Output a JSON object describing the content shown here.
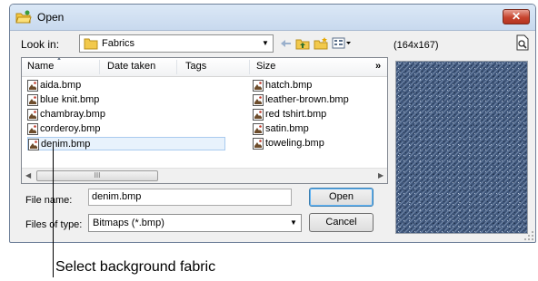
{
  "window": {
    "title": "Open",
    "close_glyph": "✕",
    "icon": "open-folder-icon"
  },
  "toolbar": {
    "look_in_label": "Look in:",
    "look_in_value": "Fabrics",
    "back_icon": "back-arrow-icon",
    "up_icon": "up-folder-icon",
    "new_folder_icon": "new-folder-icon",
    "views_icon": "views-menu-icon"
  },
  "preview_info": {
    "dimensions": "(164x167)"
  },
  "list": {
    "columns": [
      "Name",
      "Date taken",
      "Tags",
      "Size"
    ],
    "more_columns": "»",
    "files": [
      "aida.bmp",
      "blue knit.bmp",
      "chambray.bmp",
      "corderoy.bmp",
      "denim.bmp",
      "hatch.bmp",
      "leather-brown.bmp",
      "red tshirt.bmp",
      "satin.bmp",
      "toweling.bmp"
    ],
    "selected_index": 4,
    "scroll_thumb": "III"
  },
  "form": {
    "file_name_label": "File name:",
    "file_name_value": "denim.bmp",
    "files_of_type_label": "Files of type:",
    "files_of_type_value": "Bitmaps (*.bmp)",
    "open_button": "Open",
    "cancel_button": "Cancel"
  },
  "callout": {
    "text": "Select background fabric"
  },
  "colors": {
    "denim": "#3d5478",
    "selection": "#e8f2fc",
    "close": "#c7442e"
  }
}
